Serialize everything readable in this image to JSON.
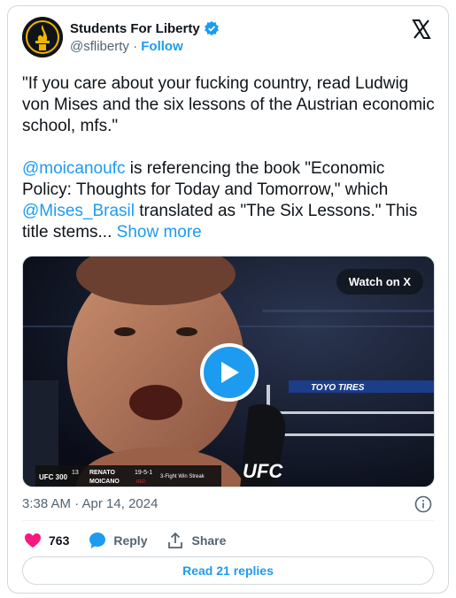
{
  "author": {
    "name": "Students For Liberty",
    "handle": "@sfliberty",
    "separator": "·",
    "follow_label": "Follow"
  },
  "tweet": {
    "quote": "\"If you care about your fucking country, read Ludwig von Mises and the six lessons of the Austrian economic school, mfs.\"",
    "mention1": "@moicanoufc",
    "text1": " is referencing the book \"Economic Policy: Thoughts for Today and Tomorrow,\" which ",
    "mention2": "@Mises_Brasil",
    "text2": " translated as \"The Six Lessons.\" This title stems... ",
    "show_more": "Show more"
  },
  "video": {
    "watch_label": "Watch on X",
    "overlay": {
      "event": "UFC 300",
      "rank": "13",
      "fighter_first": "RENATO",
      "fighter_last": "MOICANO",
      "record": "19-5-1",
      "corner": "RED",
      "streak": "3-Fight Win Streak",
      "banner_text": "TOYO TIRES",
      "brand": "UFC"
    }
  },
  "meta": {
    "timestamp": "3:38 AM · Apr 14, 2024"
  },
  "actions": {
    "likes": "763",
    "reply_label": "Reply",
    "share_label": "Share"
  },
  "replies_label": "Read 21 replies",
  "colors": {
    "accent": "#1d9bf0",
    "like": "#f91880",
    "text": "#0f1419",
    "muted": "#536471",
    "border": "#cfd9de"
  },
  "icons": [
    "avatar-logo",
    "verified-badge-icon",
    "x-logo-icon",
    "play-icon",
    "info-icon",
    "heart-icon",
    "reply-bubble-icon",
    "share-icon"
  ]
}
